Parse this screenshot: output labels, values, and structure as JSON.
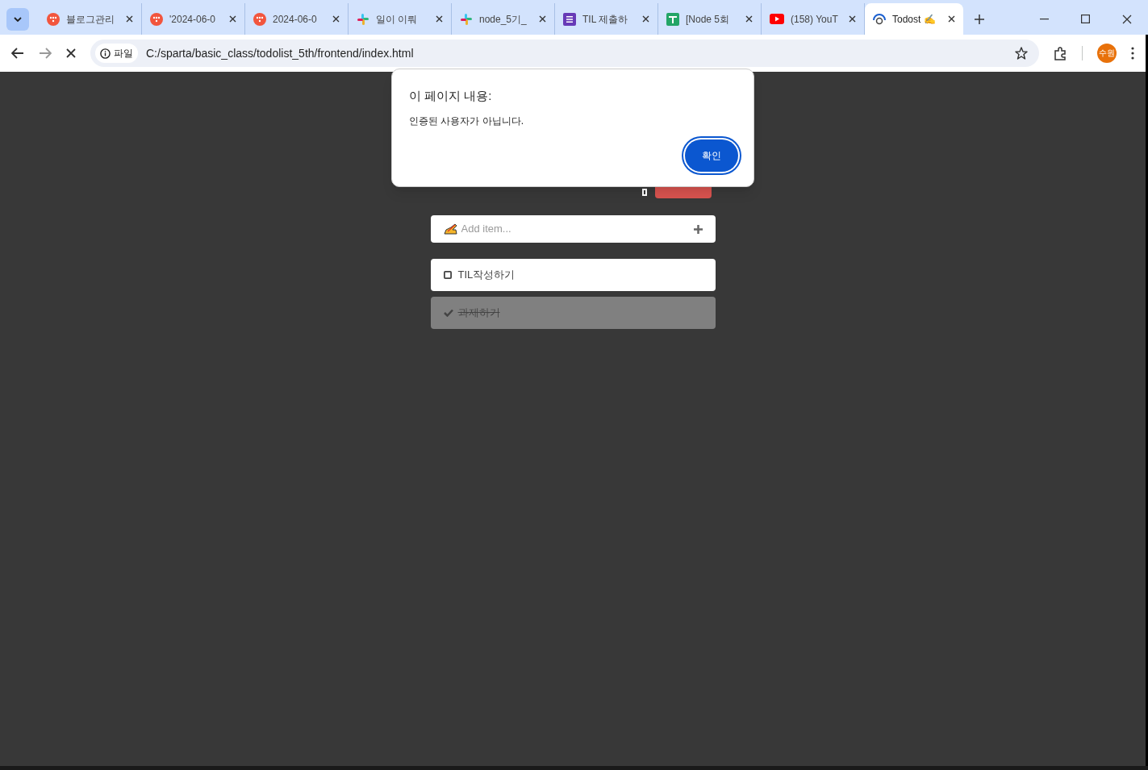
{
  "tabs": [
    {
      "title": "블로그관리",
      "kind": "tistory",
      "selected": false
    },
    {
      "title": "'2024-06-0",
      "kind": "tistory",
      "selected": false
    },
    {
      "title": "2024-06-0",
      "kind": "tistory",
      "selected": false
    },
    {
      "title": "일이 이뤄",
      "kind": "slack",
      "selected": false
    },
    {
      "title": "node_5기_",
      "kind": "slack",
      "selected": false
    },
    {
      "title": "TIL 제출하",
      "kind": "form",
      "selected": false
    },
    {
      "title": "[Node 5회",
      "kind": "sheet",
      "selected": false
    },
    {
      "title": "(158) YouT",
      "kind": "youtube",
      "selected": false
    },
    {
      "title": "Todost ✍️",
      "kind": "page",
      "selected": true
    }
  ],
  "address_bar": {
    "scheme_label": "파일",
    "url": "C:/sparta/basic_class/todolist_5th/frontend/index.html"
  },
  "profile": {
    "initials": "수원"
  },
  "add_item": {
    "placeholder": "Add item..."
  },
  "todos": [
    {
      "text": "TIL작성하기",
      "done": false
    },
    {
      "text": "과제하기",
      "done": true
    }
  ],
  "dialog": {
    "title": "이 페이지 내용:",
    "message": "인증된 사용자가 아닙니다.",
    "button": "확인"
  }
}
